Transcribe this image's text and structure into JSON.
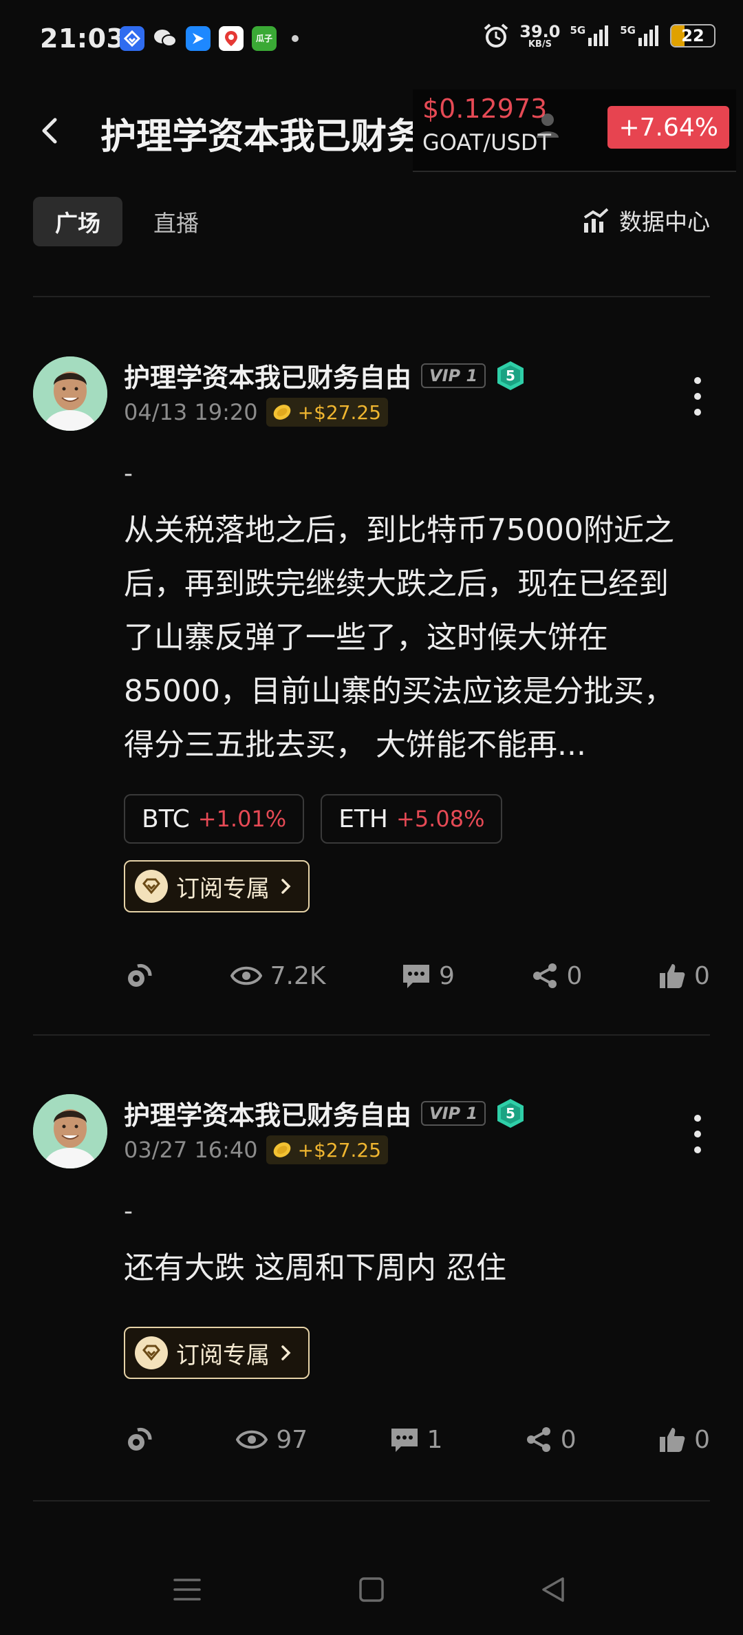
{
  "status_bar": {
    "time": "21:03",
    "net_speed": "39.0",
    "net_speed_unit": "KB/S",
    "signal1_label": "5G",
    "signal2_label": "5G",
    "battery": "22",
    "notif_app_label": "瓜子"
  },
  "header": {
    "title": "护理学资本我已财务自由",
    "price": "$0.12973",
    "pair": "GOAT/USDT",
    "change": "+7.64%"
  },
  "tabs": {
    "square": "广场",
    "live": "直播",
    "data_center": "数据中心"
  },
  "posts": [
    {
      "author": "护理学资本我已财务自由",
      "vip": "VIP 1",
      "level": "5",
      "date": "04/13 19:20",
      "reward": "+$27.25",
      "dash": "-",
      "body": "从关税落地之后，到比特币75000附近之后，再到跌完继续大跌之后，现在已经到了山寨反弹了一些了，这时候大饼在85000，目前山寨的买法应该是分批买，得分三五批去买， 大饼能不能再...",
      "coins": [
        {
          "symbol": "BTC",
          "change": "+1.01%"
        },
        {
          "symbol": "ETH",
          "change": "+5.08%"
        }
      ],
      "subscribe": "订阅专属",
      "views": "7.2K",
      "comments": "9",
      "shares": "0",
      "likes": "0"
    },
    {
      "author": "护理学资本我已财务自由",
      "vip": "VIP 1",
      "level": "5",
      "date": "03/27 16:40",
      "reward": "+$27.25",
      "dash": "-",
      "body": "还有大跌 这周和下周内 忍住",
      "subscribe": "订阅专属",
      "views": "97",
      "comments": "1",
      "shares": "0",
      "likes": "0"
    }
  ],
  "colors": {
    "background": "#0b0b0b",
    "up_red": "#e64a55",
    "reward_gold": "#f0b630",
    "level_teal": "#2fcfa8"
  }
}
